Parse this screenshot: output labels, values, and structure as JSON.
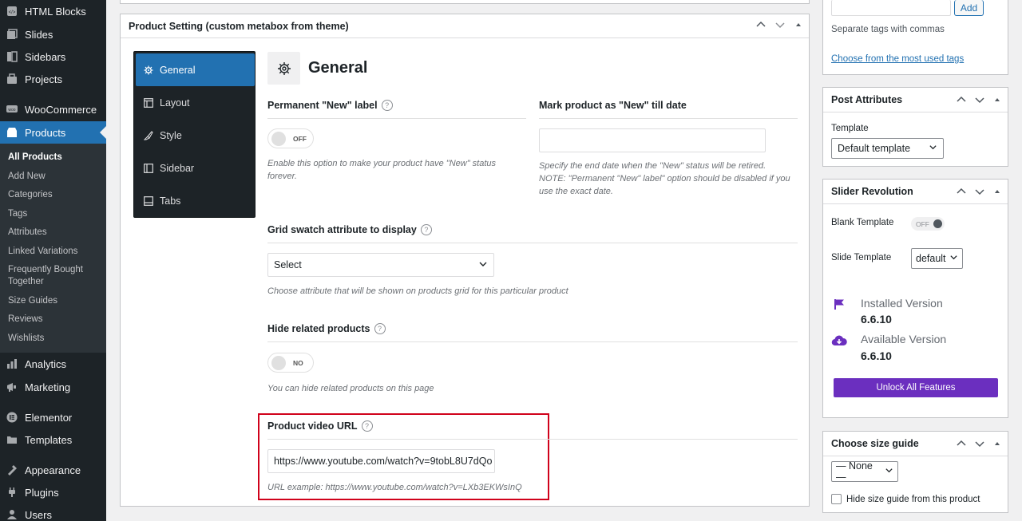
{
  "sidebar": {
    "top_items": [
      {
        "label": "HTML Blocks",
        "icon": "html-blocks-icon"
      },
      {
        "label": "Slides",
        "icon": "slides-icon"
      },
      {
        "label": "Sidebars",
        "icon": "sidebars-icon"
      },
      {
        "label": "Projects",
        "icon": "projects-icon"
      },
      {
        "label": "WooCommerce",
        "icon": "woocommerce-icon"
      },
      {
        "label": "Products",
        "icon": "products-icon"
      }
    ],
    "submenu": [
      "All Products",
      "Add New",
      "Categories",
      "Tags",
      "Attributes",
      "Linked Variations",
      "Frequently Bought Together",
      "Size Guides",
      "Reviews",
      "Wishlists"
    ],
    "bottom_items": [
      {
        "label": "Analytics",
        "icon": "analytics-icon"
      },
      {
        "label": "Marketing",
        "icon": "marketing-icon"
      },
      {
        "label": "Elementor",
        "icon": "elementor-icon"
      },
      {
        "label": "Templates",
        "icon": "templates-icon"
      },
      {
        "label": "Appearance",
        "icon": "appearance-icon"
      },
      {
        "label": "Plugins",
        "icon": "plugins-icon"
      },
      {
        "label": "Users",
        "icon": "users-icon"
      }
    ]
  },
  "metabox": {
    "title": "Product Setting (custom metabox from theme)",
    "tabs": [
      "General",
      "Layout",
      "Style",
      "Sidebar",
      "Tabs"
    ],
    "panel_title": "General",
    "new_label": {
      "label": "Permanent \"New\" label",
      "toggle": "OFF",
      "desc": "Enable this option to make your product have \"New\" status forever."
    },
    "new_till": {
      "label": "Mark product as \"New\" till date",
      "value": "",
      "desc": "Specify the end date when the \"New\" status will be retired. NOTE: \"Permanent \"New\" label\" option should be disabled if you use the exact date."
    },
    "swatch": {
      "label": "Grid swatch attribute to display",
      "value": "Select",
      "desc": "Choose attribute that will be shown on products grid for this particular product"
    },
    "hide_related": {
      "label": "Hide related products",
      "toggle": "NO",
      "desc": "You can hide related products on this page"
    },
    "video": {
      "label": "Product video URL",
      "value": "https://www.youtube.com/watch?v=9tobL8U7dQo",
      "desc": "URL example: https://www.youtube.com/watch?v=LXb3EKWsInQ"
    },
    "help_mark": "?"
  },
  "tags_box": {
    "add_label": "Add",
    "hint": "Separate tags with commas",
    "link": "Choose from the most used tags"
  },
  "post_attributes": {
    "title": "Post Attributes",
    "template_label": "Template",
    "template_value": "Default template"
  },
  "slider_revolution": {
    "title": "Slider Revolution",
    "blank_label": "Blank Template",
    "blank_toggle": "OFF",
    "slide_label": "Slide Template",
    "slide_value": "default",
    "installed_label": "Installed Version",
    "installed_value": "6.6.10",
    "available_label": "Available Version",
    "available_value": "6.6.10",
    "unlock": "Unlock All Features",
    "accent": "#6b2fbf"
  },
  "size_guide": {
    "title": "Choose size guide",
    "value": "— None —",
    "hide_label": "Hide size guide from this product"
  },
  "colors": {
    "admin_blue": "#2271b1",
    "sidebar_dark": "#1d2327",
    "highlight_red": "#d0021b"
  }
}
